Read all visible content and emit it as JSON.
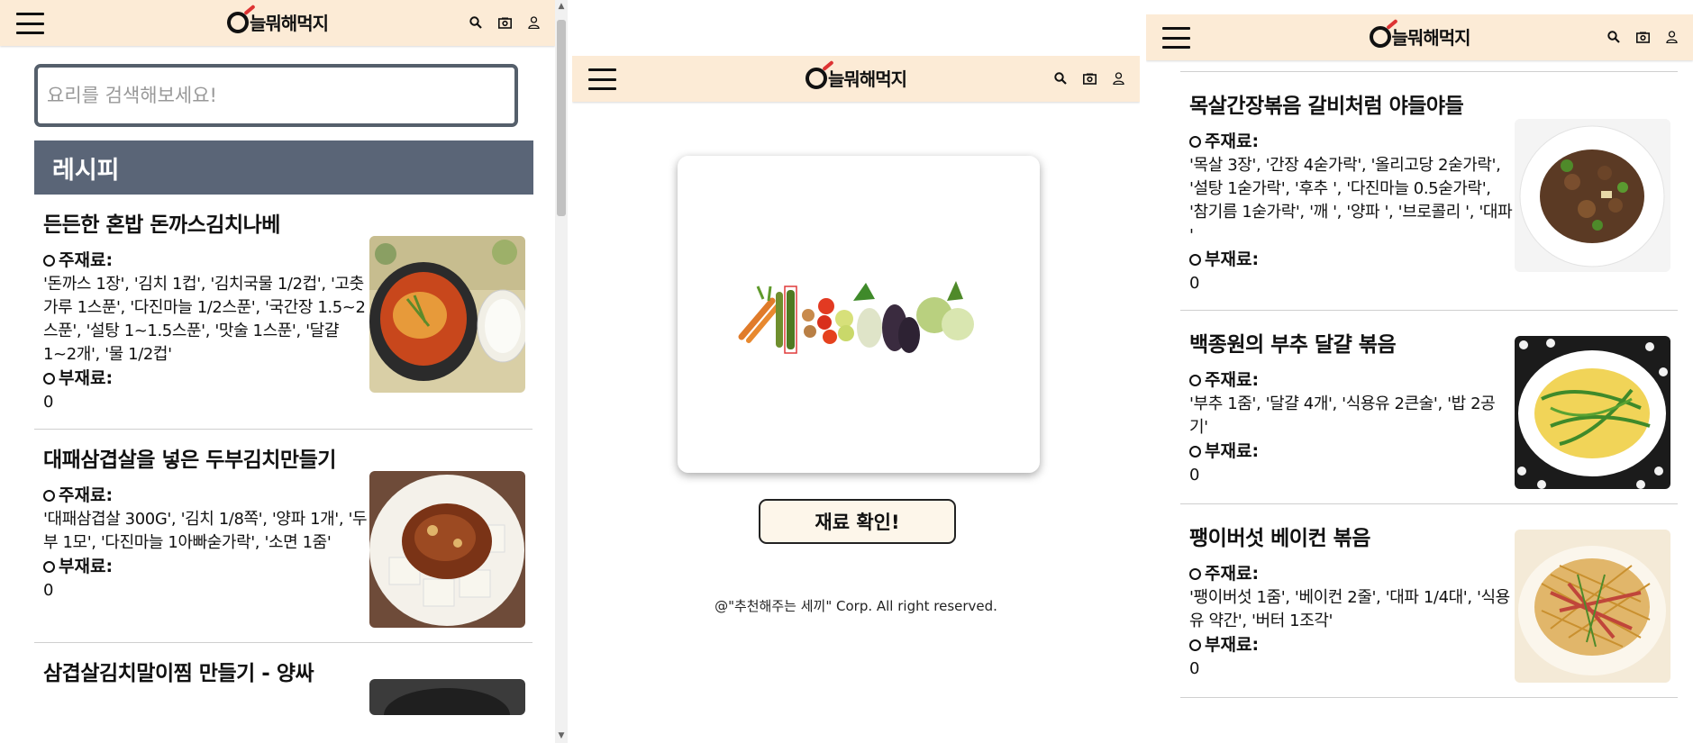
{
  "app": {
    "logo_text": "늘뭐해먹지",
    "logo_small": "뭐"
  },
  "search": {
    "placeholder": "요리를 검색해보세요!"
  },
  "section": {
    "title": "레시피"
  },
  "labels": {
    "main_ingredients": "주재료:",
    "sub_ingredients": "부재료:"
  },
  "recipes_left": [
    {
      "title": "든든한 혼밥 돈까스김치나베",
      "main": "'돈까스 1장', '김치 1컵', '김치국물 1/2컵', '고춧가루 1스푼', '다진마늘 1/2스푼', '국간장 1.5~2스푼', '설탕 1~1.5스푼', '맛술 1스푼', '달걀 1~2개', '물 1/2컵'",
      "sub": "0"
    },
    {
      "title": "대패삼겹살을 넣은 두부김치만들기",
      "main": "'대패삼겹살 300G', '김치 1/8쪽', '양파 1개', '두부 1모', '다진마늘 1아빠숟가락', '소면 1줌'",
      "sub": "0"
    },
    {
      "title": "삼겹살김치말이찜 만들기 - 양싸",
      "main": "",
      "sub": ""
    }
  ],
  "camera_screen": {
    "confirm_label": "재료 확인!",
    "footer": "@\"추천해주는 세끼\" Corp. All right reserved."
  },
  "recipes_right": [
    {
      "title": "목살간장볶음 갈비처럼 야들야들",
      "main": "'목살 3장', '간장 4숟가락', '올리고당 2숟가락', '설탕 1숟가락', '후추 ', '다진마늘 0.5숟가락', '참기름 1숟가락', '깨 ', '양파 ', '브로콜리 ', '대파 '",
      "sub": "0"
    },
    {
      "title": "백종원의 부추 달걀 볶음",
      "main": "'부추 1줌', '달걀 4개', '식용유 2큰술', '밥 2공기'",
      "sub": "0"
    },
    {
      "title": "팽이버섯 베이컨 볶음",
      "main": "'팽이버섯 1줌', '베이컨 2줄', '대파 1/4대', '식용유 약간', '버터 1조각'",
      "sub": "0"
    }
  ],
  "icons": [
    "menu-icon",
    "search-icon",
    "camera-icon",
    "user-icon"
  ],
  "colors": {
    "appbar": "#fcebd6",
    "section_header": "#5a6577",
    "search_border": "#555f6b",
    "button_bg": "#fdf6ea"
  }
}
